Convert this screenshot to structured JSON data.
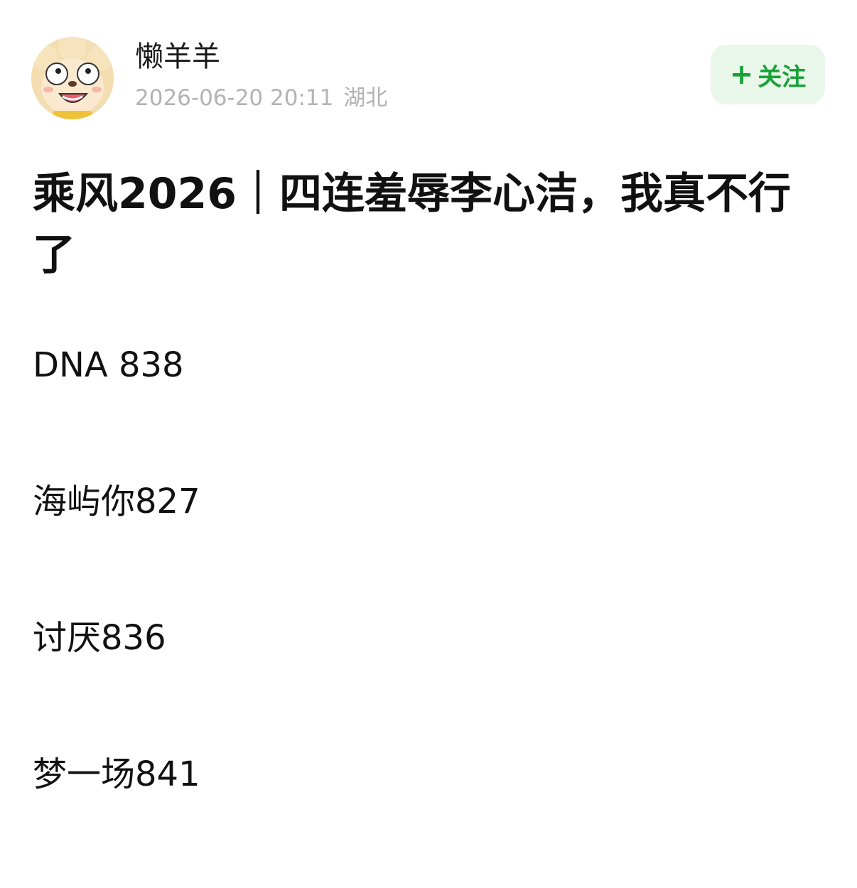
{
  "author": {
    "name": "懒羊羊",
    "avatar_icon": "lazy-sheep-avatar",
    "datetime": "2026-06-20 20:11",
    "location": "湖北"
  },
  "follow_button": {
    "icon": "plus-icon",
    "plus": "+",
    "label": "关注",
    "color": "#18a238",
    "background": "#e9f7ea"
  },
  "post": {
    "title": "乘风2026｜四连羞辱李心洁，我真不行了",
    "lines": [
      "DNA 838",
      "海屿你827",
      "讨厌836",
      "梦一场841"
    ]
  }
}
